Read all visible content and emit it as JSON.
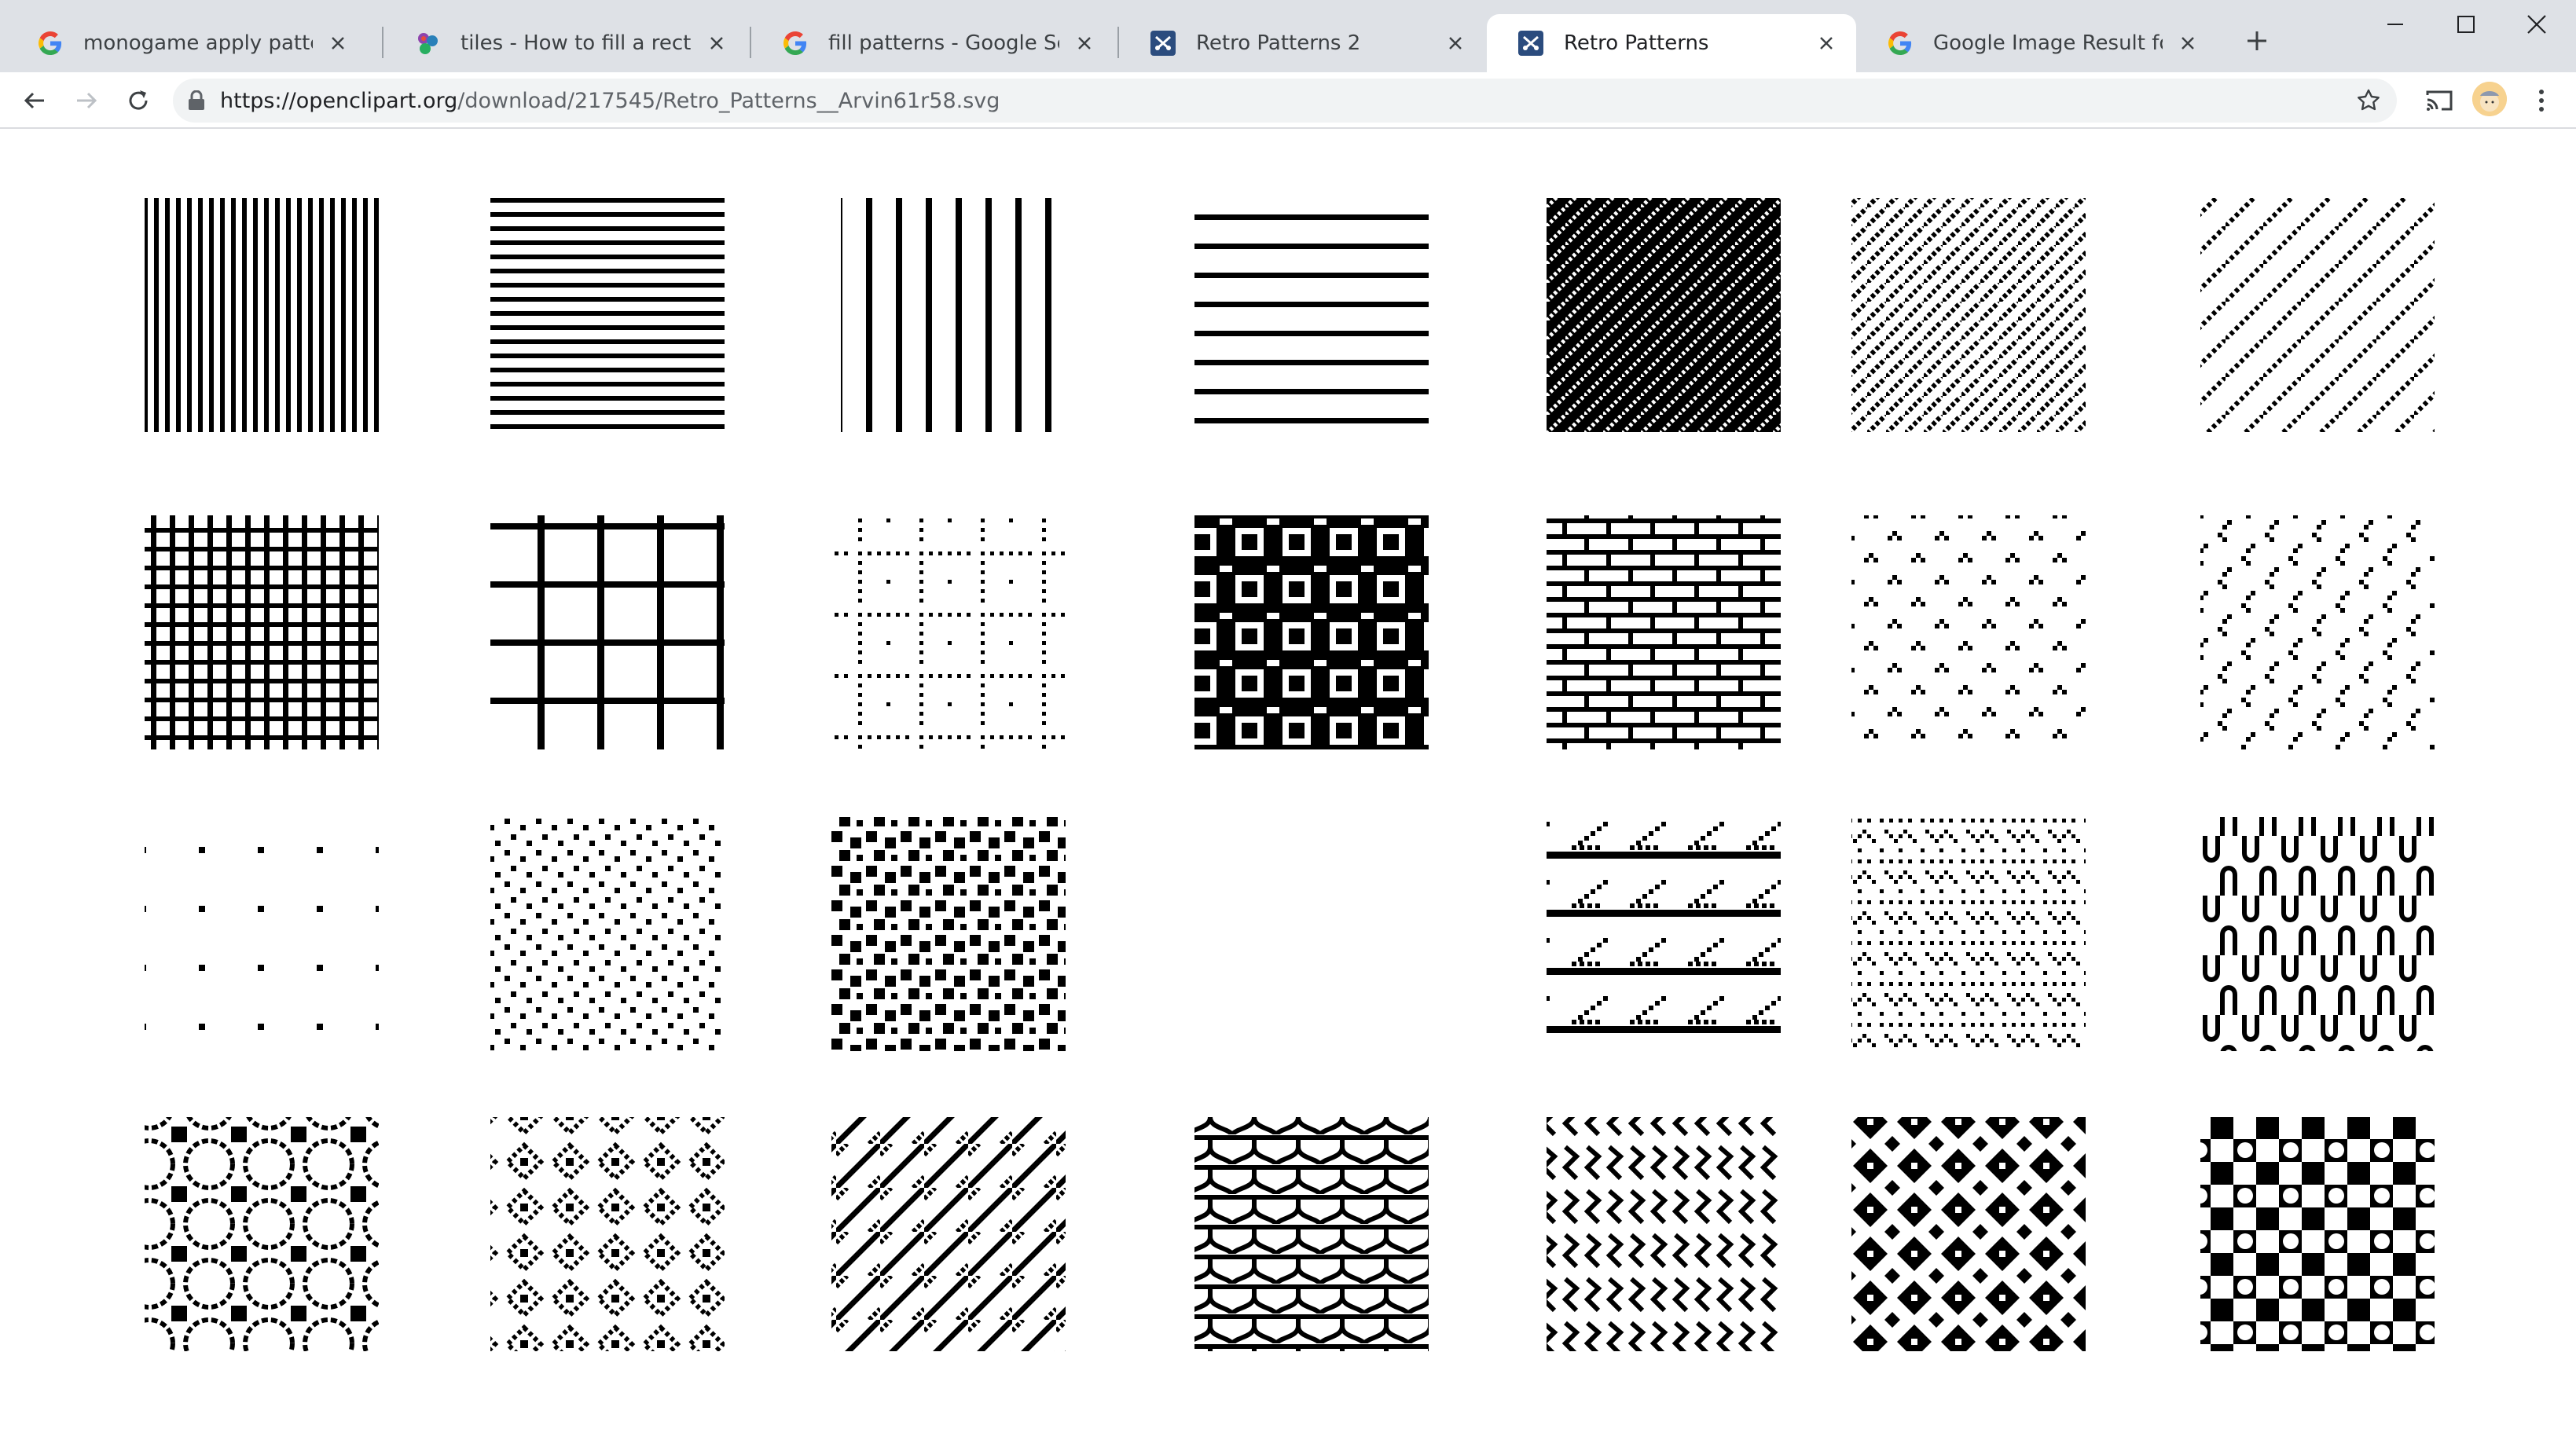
{
  "browser": {
    "tabs": [
      {
        "title": "monogame apply pattern to tex",
        "favicon": "google-icon",
        "active": false
      },
      {
        "title": "tiles - How to fill a rectangle wit",
        "favicon": "gamedev-icon",
        "active": false
      },
      {
        "title": "fill patterns - Google Search",
        "favicon": "google-icon",
        "active": false
      },
      {
        "title": "Retro Patterns 2",
        "favicon": "openclipart-icon",
        "active": false
      },
      {
        "title": "Retro Patterns",
        "favicon": "openclipart-icon",
        "active": true
      },
      {
        "title": "Google Image Result for https:/",
        "favicon": "google-icon",
        "active": false
      }
    ],
    "address": {
      "host": "https://openclipart.org",
      "path": "/download/217545/Retro_Patterns__Arvin61r58.svg"
    },
    "icons": {
      "back": "back-arrow-icon",
      "forward": "forward-arrow-icon",
      "reload": "reload-icon",
      "lock": "lock-icon",
      "star": "bookmark-star-icon",
      "cast": "cast-icon",
      "menu": "kebab-menu-icon",
      "new_tab": "plus-icon",
      "minimize": "minimize-icon",
      "maximize": "maximize-icon",
      "close": "close-icon"
    }
  },
  "patterns": {
    "row1": [
      "vertical-lines-dense",
      "horizontal-lines-dense",
      "vertical-lines-wide",
      "horizontal-lines-wide",
      "diagonal-dense-dark",
      "diagonal-dotted",
      "diagonal-sparse"
    ],
    "row2": [
      "grid-fine",
      "grid-wide",
      "dotted-grid",
      "square-tiles",
      "bricks",
      "triangle-dots",
      "zigzag-dots"
    ],
    "row3": [
      "sparse-dots",
      "scattered-dots",
      "scattered-squares",
      "blank",
      "stair-stripes",
      "zigzag-waves",
      "wavy-columns"
    ],
    "row4": [
      "rings-lattice",
      "diamond-lattice",
      "diagonal-weave",
      "scales",
      "wave-lattice",
      "dark-checker-diamond",
      "dark-checker-circle"
    ]
  },
  "colors": {
    "tabstrip": "#dee1e6",
    "window_border": "#2e7d32",
    "pattern_ink": "#000000"
  }
}
